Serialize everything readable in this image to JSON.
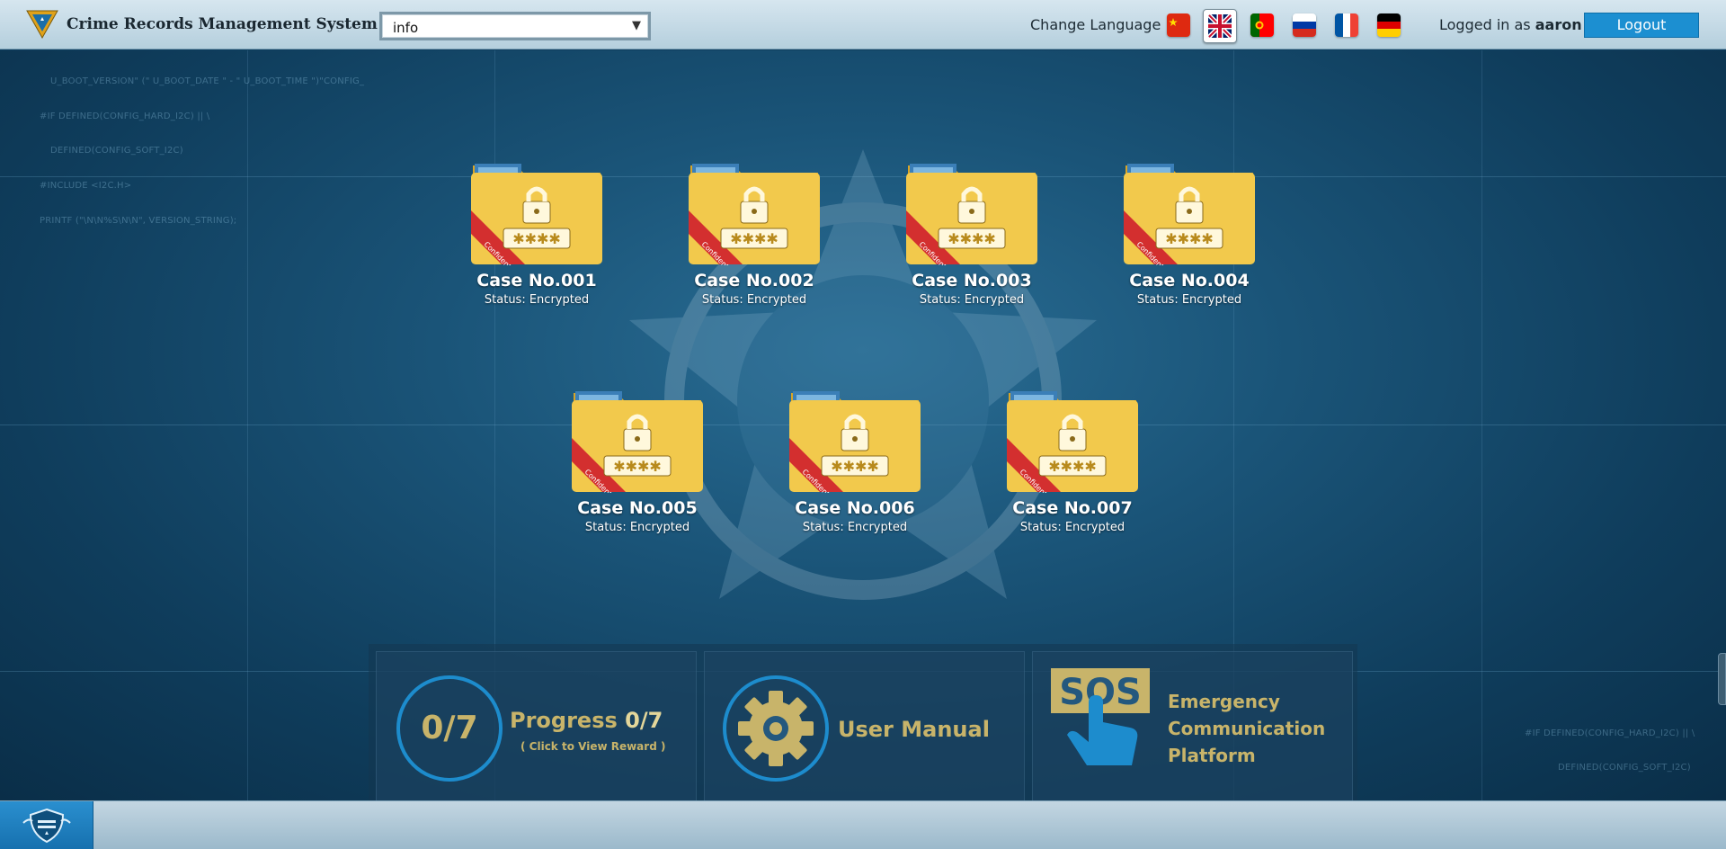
{
  "header": {
    "title": "Crime Records Management System V1.3",
    "select_value": "info",
    "change_language_label": "Change Language :",
    "logged_in_prefix": "Logged in as",
    "username": "aaron",
    "logout_label": "Logout",
    "languages": [
      "chinese-flag",
      "uk-flag",
      "portugal-flag",
      "russia-flag",
      "france-flag",
      "germany-flag"
    ],
    "active_language": "uk-flag"
  },
  "code_lines_left": [
    "U_BOOT_VERSION\" (\" U_BOOT_DATE \" - \" U_BOOT_TIME \")\"CONFIG_",
    "#IF DEFINED(CONFIG_HARD_I2C) || \\",
    "DEFINED(CONFIG_SOFT_I2C)",
    "#INCLUDE <I2C.H>",
    "PRINTF (\"\\N\\N%S\\N\\N\", VERSION_STRING);"
  ],
  "code_lines_right": [
    "#IF DEFINED(CONFIG_HARD_I2C) || \\",
    "DEFINED(CONFIG_SOFT_I2C)"
  ],
  "cases": [
    {
      "title": "Case No.001",
      "status": "Status: Encrypted"
    },
    {
      "title": "Case No.002",
      "status": "Status: Encrypted"
    },
    {
      "title": "Case No.003",
      "status": "Status: Encrypted"
    },
    {
      "title": "Case No.004",
      "status": "Status: Encrypted"
    },
    {
      "title": "Case No.005",
      "status": "Status: Encrypted"
    },
    {
      "title": "Case No.006",
      "status": "Status: Encrypted"
    },
    {
      "title": "Case No.007",
      "status": "Status: Encrypted"
    }
  ],
  "folder_tag": "Confidential",
  "progress": {
    "ring_text": "0/7",
    "label": "Progress",
    "value": "0/7",
    "sub": "( Click to View Reward )",
    "completed": 0,
    "total": 7
  },
  "manual": {
    "label": "User Manual"
  },
  "sos": {
    "label_line1": "Emergency",
    "label_line2": "Communication",
    "label_line3": "Platform",
    "sign_text": "SOS"
  },
  "colors": {
    "accent": "#1c8fd1",
    "gold": "#c8b46a",
    "folder": "#f2c94c"
  }
}
